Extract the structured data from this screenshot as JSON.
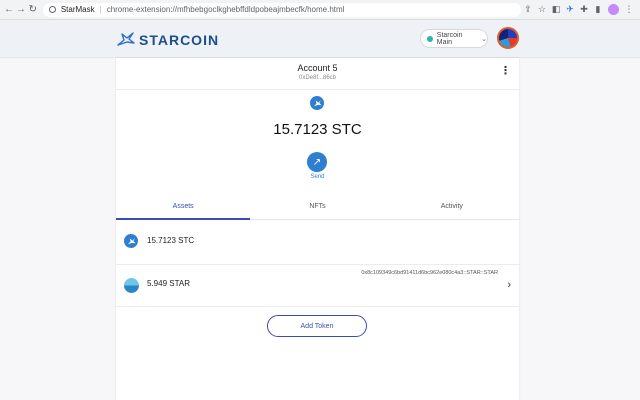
{
  "browser": {
    "app_name": "StarMask",
    "separator": "|",
    "url": "chrome-extension://mfhbebgoclkghebffdldpobeajmbecfk/home.html",
    "accent": "#1a73e8"
  },
  "header": {
    "logo_text": "STARCOIN",
    "network_label": "Starcoin Main",
    "network_status_color": "#29b6af"
  },
  "account": {
    "name": "Account 5",
    "address_short": "0xDe8f...86cb"
  },
  "balance": {
    "display": "15.7123 STC",
    "send_label": "Send"
  },
  "tabs": [
    {
      "label": "Assets",
      "active": true
    },
    {
      "label": "NFTs",
      "active": false
    },
    {
      "label": "Activity",
      "active": false
    }
  ],
  "assets": [
    {
      "amount": "15.7123 STC",
      "token_id": ""
    },
    {
      "amount": "5.949 STAR",
      "token_id": "0x8c109349c6bd91411d6bc962e080c4a3::STAR::STAR"
    }
  ],
  "add_token_label": "Add Token",
  "colors": {
    "brand_blue": "#2f7fd1",
    "tab_active": "#3a4db7",
    "logo": "#1c4f8f"
  }
}
